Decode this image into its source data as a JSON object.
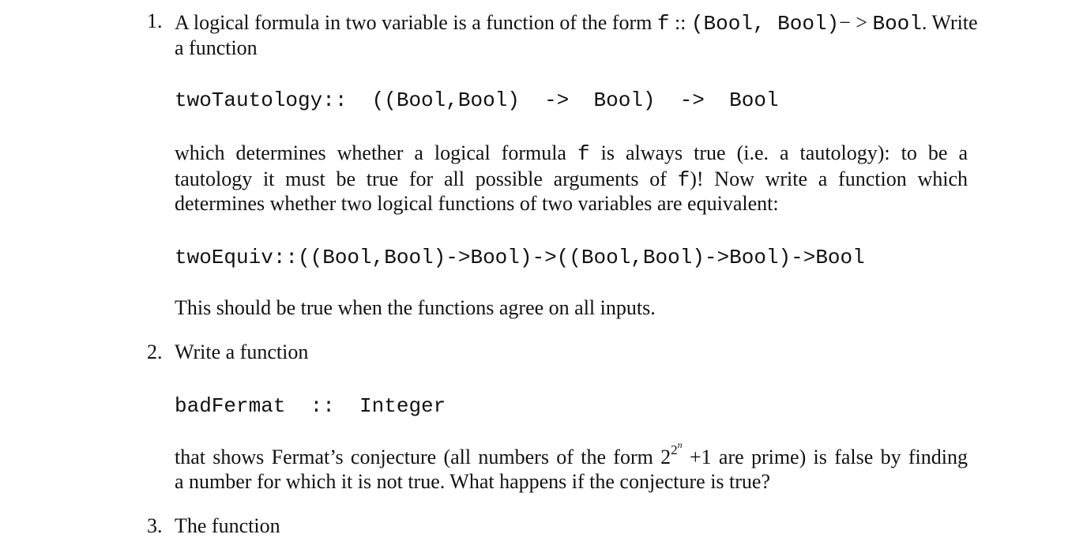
{
  "items": [
    {
      "number": "1.",
      "line1": {
        "pre": "A logical formula in two variable is a function of the form ",
        "code_f": "f",
        "colons": " :: ",
        "code_sig": "(Bool, Bool)",
        "arrow": "− >",
        "code_result": "Bool",
        "post": ". Write"
      },
      "line2": "a function",
      "code1": "twoTautology::  ((Bool,Bool)  ->  Bool)  ->  Bool",
      "para1": {
        "line1": {
          "pre": "which determines whether a logical formula ",
          "code_f": "f",
          "post": " is always true (i.e.  a tautology):  to be a"
        },
        "line2": {
          "pre": "tautology it must be true for all possible arguments of ",
          "code_f": "f",
          "post": ")!  Now write a function which"
        },
        "line3": "determines whether two logical functions of two variables are equivalent:"
      },
      "code2": "twoEquiv::((Bool,Bool)->Bool)->((Bool,Bool)->Bool)->Bool",
      "para2": "This should be true when the functions agree on all inputs."
    },
    {
      "number": "2.",
      "intro": "Write a function",
      "code": "badFermat  ::  Integer",
      "para": {
        "line1": {
          "pre": "that shows Fermat’s conjecture (all numbers of the form 2",
          "sup": "2",
          "supsup": "n",
          "post": " +1 are prime) is false by finding"
        },
        "line2": "a number for which it is not true. What happens if the conjecture is true?"
      }
    },
    {
      "number": "3.",
      "intro": "The function"
    }
  ]
}
